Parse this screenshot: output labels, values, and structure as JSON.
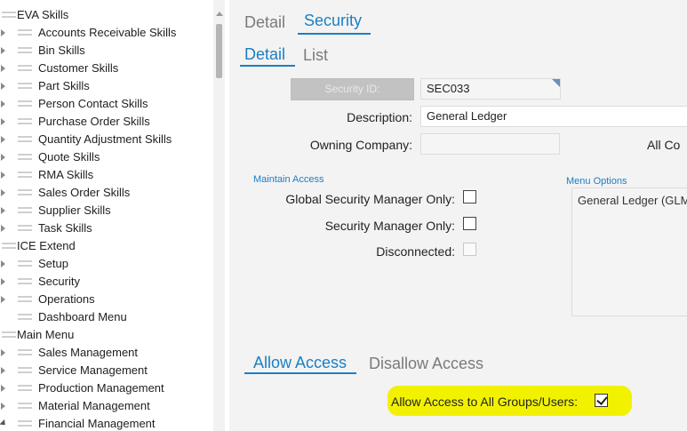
{
  "tree": {
    "items": [
      {
        "label": "EVA Skills",
        "level": "top",
        "expander": "none"
      },
      {
        "label": "Accounts Receivable Skills",
        "level": "child",
        "expander": "closed"
      },
      {
        "label": "Bin Skills",
        "level": "child",
        "expander": "closed"
      },
      {
        "label": "Customer Skills",
        "level": "child",
        "expander": "closed"
      },
      {
        "label": "Part Skills",
        "level": "child",
        "expander": "closed"
      },
      {
        "label": "Person Contact Skills",
        "level": "child",
        "expander": "closed"
      },
      {
        "label": "Purchase Order Skills",
        "level": "child",
        "expander": "closed"
      },
      {
        "label": "Quantity Adjustment Skills",
        "level": "child",
        "expander": "closed"
      },
      {
        "label": "Quote Skills",
        "level": "child",
        "expander": "closed"
      },
      {
        "label": "RMA Skills",
        "level": "child",
        "expander": "closed"
      },
      {
        "label": "Sales Order Skills",
        "level": "child",
        "expander": "closed"
      },
      {
        "label": "Supplier Skills",
        "level": "child",
        "expander": "closed"
      },
      {
        "label": "Task Skills",
        "level": "child",
        "expander": "closed"
      },
      {
        "label": "ICE Extend",
        "level": "top",
        "expander": "none"
      },
      {
        "label": "Setup",
        "level": "child",
        "expander": "closed"
      },
      {
        "label": "Security",
        "level": "child",
        "expander": "closed"
      },
      {
        "label": "Operations",
        "level": "child",
        "expander": "closed"
      },
      {
        "label": "Dashboard Menu",
        "level": "child",
        "expander": "none"
      },
      {
        "label": "Main Menu",
        "level": "top",
        "expander": "none"
      },
      {
        "label": "Sales Management",
        "level": "child",
        "expander": "closed"
      },
      {
        "label": "Service Management",
        "level": "child",
        "expander": "closed"
      },
      {
        "label": "Production Management",
        "level": "child",
        "expander": "closed"
      },
      {
        "label": "Material Management",
        "level": "child",
        "expander": "closed"
      },
      {
        "label": "Financial Management",
        "level": "child",
        "expander": "open"
      }
    ]
  },
  "top_tabs": [
    {
      "label": "Detail",
      "active": false
    },
    {
      "label": "Security",
      "active": true
    }
  ],
  "sub_tabs": [
    {
      "label": "Detail",
      "active": true
    },
    {
      "label": "List",
      "active": false
    }
  ],
  "form": {
    "security_id_button": "Security ID:",
    "security_id_value": "SEC033",
    "description_label": "Description:",
    "description_value": "General Ledger",
    "owning_company_label": "Owning Company:",
    "owning_company_value": "",
    "all_companies_label": "All Co"
  },
  "maintain_access": {
    "title": "Maintain Access",
    "global_label": "Global Security Manager Only:",
    "global_checked": false,
    "manager_label": "Security Manager Only:",
    "manager_checked": false,
    "disconnected_label": "Disconnected:",
    "disconnected_checked": false
  },
  "menu_options": {
    "title": "Menu Options",
    "item": "General Ledger (GLM"
  },
  "access_tabs": [
    {
      "label": "Allow Access",
      "active": true
    },
    {
      "label": "Disallow Access",
      "active": false
    }
  ],
  "allow_all": {
    "label": "Allow Access to All Groups/Users:",
    "checked": true
  },
  "colors": {
    "accent": "#1a7fc4",
    "highlight": "#f2f200",
    "panel": "#f3f3f3"
  }
}
